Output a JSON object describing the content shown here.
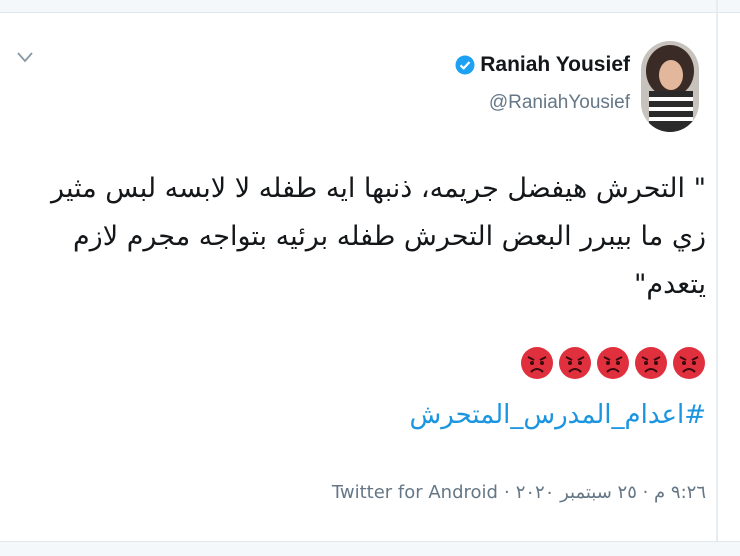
{
  "user": {
    "name": "Raniah Yousief",
    "handle": "@RaniahYousief",
    "verified": true
  },
  "tweet": {
    "text_lines": [
      "\" التحرش هيفضل جريمه، ذنبها ايه طفله لا لابسه لبس مثير",
      "زي ما بيبرر البعض التحرش طفله برئيه بتواجه مجرم لازم",
      "يتعدم\""
    ],
    "emoji_count": 5,
    "emoji_name": "pouting-face",
    "hashtag": "#اعدام_المدرس_المتحرش",
    "timestamp": "٩:٢٦ م · ٢٥ سبتمبر ٢٠٢٠",
    "separator": "·",
    "source": "Twitter for Android"
  },
  "colors": {
    "link": "#1b95e0",
    "muted": "#657786",
    "text": "#14171a",
    "emoji": "#e0303d"
  }
}
